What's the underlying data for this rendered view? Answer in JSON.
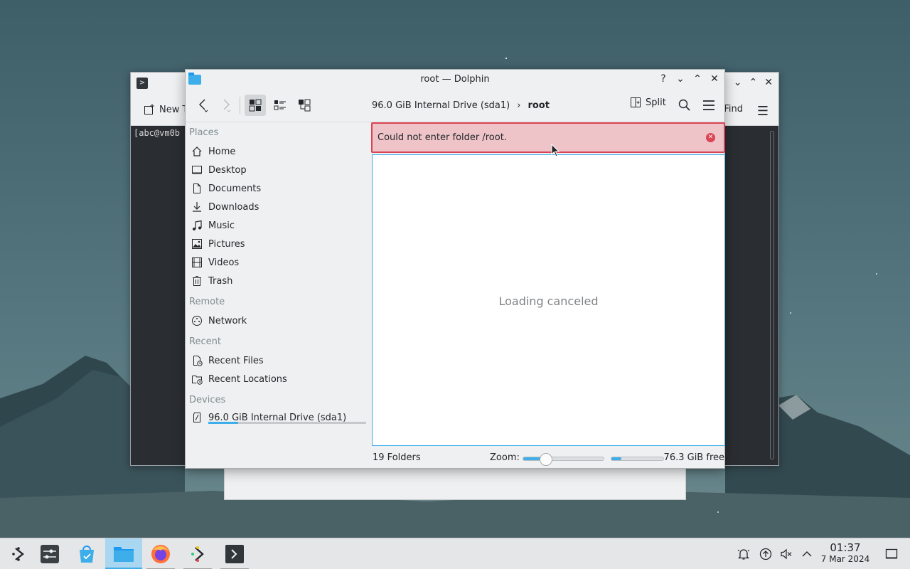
{
  "terminal": {
    "new_tab_label": "New Tab",
    "find_label": "Find",
    "prompt_text": "[abc@vm0b"
  },
  "dolphin": {
    "title": "root — Dolphin",
    "toolbar": {
      "back_icon": "go-previous-icon",
      "forward_icon": "go-next-icon",
      "view_icons": "view-list-icons",
      "view_details": "view-list-details",
      "view_tree": "view-list-tree",
      "split_label": "Split"
    },
    "breadcrumb": {
      "drive": "96.0 GiB Internal Drive (sda1)",
      "current": "root"
    },
    "places": {
      "sections": {
        "places": "Places",
        "remote": "Remote",
        "recent": "Recent",
        "devices": "Devices"
      },
      "items": [
        {
          "label": "Home",
          "icon": "home-icon"
        },
        {
          "label": "Desktop",
          "icon": "desktop-icon"
        },
        {
          "label": "Documents",
          "icon": "documents-icon"
        },
        {
          "label": "Downloads",
          "icon": "downloads-icon"
        },
        {
          "label": "Music",
          "icon": "music-icon"
        },
        {
          "label": "Pictures",
          "icon": "pictures-icon"
        },
        {
          "label": "Videos",
          "icon": "videos-icon"
        },
        {
          "label": "Trash",
          "icon": "trash-icon"
        }
      ],
      "remote_items": [
        {
          "label": "Network",
          "icon": "network-icon"
        }
      ],
      "recent_items": [
        {
          "label": "Recent Files",
          "icon": "recent-files-icon"
        },
        {
          "label": "Recent Locations",
          "icon": "recent-locations-icon"
        }
      ],
      "device": {
        "label": "96.0 GiB Internal Drive (sda1)",
        "icon": "drive-icon",
        "usage_fraction": 0.19
      }
    },
    "error_message": "Could not enter folder /root.",
    "empty_message": "Loading canceled",
    "status": {
      "count": "19 Folders",
      "zoom_label": "Zoom:",
      "zoom_fraction": 0.28,
      "free_space": "76.3 GiB free",
      "used_fraction": 0.19
    }
  },
  "taskbar": {
    "items": [
      {
        "name": "application-launcher",
        "icon": "launcher-icon"
      },
      {
        "name": "system-settings",
        "icon": "settings-icon"
      },
      {
        "name": "discover",
        "icon": "discover-icon"
      },
      {
        "name": "dolphin",
        "icon": "folder-icon"
      },
      {
        "name": "firefox",
        "icon": "firefox-icon"
      },
      {
        "name": "kdeconnect",
        "icon": "kdeconnect-icon"
      },
      {
        "name": "konsole",
        "icon": "terminal-icon"
      }
    ],
    "clock": {
      "time": "01:37",
      "date": "7 Mar 2024"
    }
  },
  "colors": {
    "accent": "#3daee9",
    "error": "#da4453",
    "error_bg": "#eec4c8"
  }
}
